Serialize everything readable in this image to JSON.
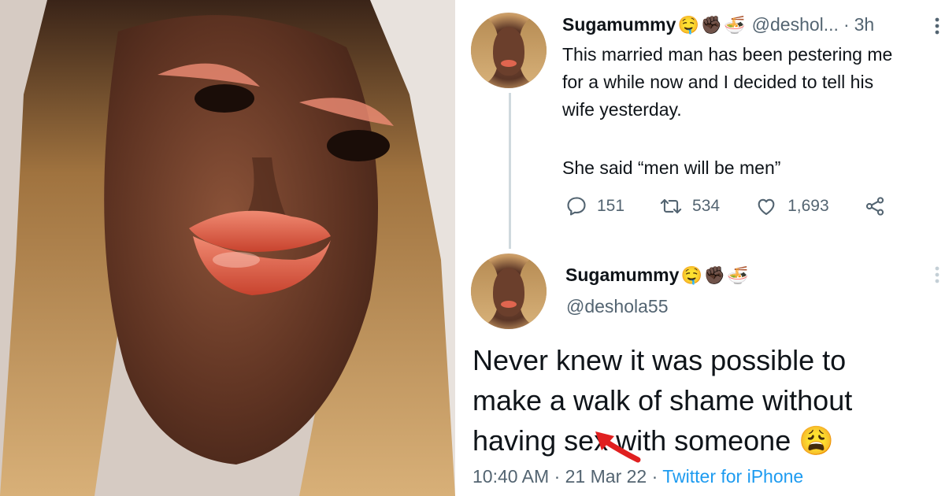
{
  "tweet1": {
    "display_name": "Sugamummy",
    "emojis": [
      "🤤",
      "✊🏿",
      "🍜"
    ],
    "handle": "@deshol...",
    "separator": "·",
    "time": "3h",
    "text_lines": [
      "This married man has been pestering me",
      "for a while now and I decided to tell his",
      "wife yesterday."
    ],
    "text_line2": "She said “men will be men”",
    "stats": {
      "replies": "151",
      "retweets": "534",
      "likes": "1,693"
    }
  },
  "tweet2": {
    "display_name": "Sugamummy",
    "emojis": [
      "🤤",
      "✊🏿",
      "🍜"
    ],
    "handle": "@deshola55",
    "text_lines": [
      "Never knew it was possible to",
      "make a walk of shame without",
      "having sex with someone 😩"
    ],
    "meta": {
      "time": "10:40 AM",
      "sep1": "·",
      "date": "21 Mar 22",
      "sep2": "·",
      "source": "Twitter for iPhone"
    }
  },
  "icons": {
    "reply": "speech-bubble-icon",
    "retweet": "retweet-icon",
    "like": "heart-icon",
    "share": "share-icon",
    "more": "vertical-dots-icon"
  },
  "colors": {
    "secondary_text": "#536471",
    "link": "#1d9bf0",
    "thread_line": "#cfd9de",
    "arrow": "#e02020"
  }
}
